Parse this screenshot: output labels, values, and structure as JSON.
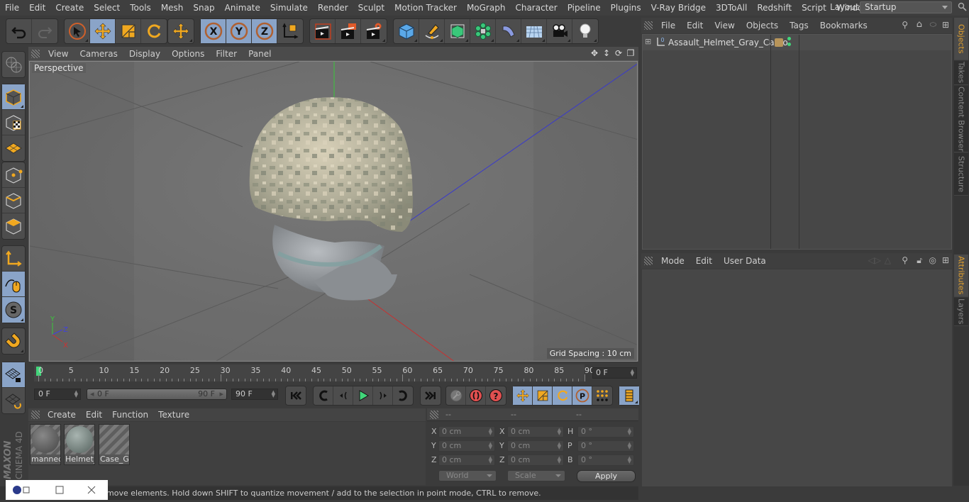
{
  "menubar": {
    "items": [
      "File",
      "Edit",
      "Create",
      "Select",
      "Tools",
      "Mesh",
      "Snap",
      "Animate",
      "Simulate",
      "Render",
      "Sculpt",
      "Motion Tracker",
      "MoGraph",
      "Character",
      "Pipeline",
      "Plugins",
      "V-Ray Bridge",
      "3DToAll",
      "Redshift",
      "Script",
      "Window",
      "Help"
    ],
    "layout_label": "Layout:",
    "layout_value": "Startup"
  },
  "toolbar": {
    "icons": [
      "undo-icon",
      "redo-icon",
      "live-selection-icon",
      "move-icon",
      "scale-icon",
      "rotate-icon",
      "recent-tool-icon",
      "x-axis-lock-icon",
      "y-axis-lock-icon",
      "z-axis-lock-icon",
      "coordinate-system-icon",
      "render-view-icon",
      "render-to-picture-viewer-icon",
      "render-settings-icon",
      "cube-icon",
      "pen-spline-icon",
      "subdivision-surface-icon",
      "cloner-icon",
      "deformer-bend-icon",
      "floor-icon",
      "camera-icon",
      "light-icon"
    ]
  },
  "left_toolbar": {
    "icons": [
      "make-editable-icon",
      "model-mode-icon",
      "texture-mode-icon",
      "workplane-mode-icon",
      "points-mode-icon",
      "edges-mode-icon",
      "polygons-mode-icon",
      "axis-mode-icon",
      "tweak-mode-icon",
      "solo-icon",
      "snap-icon",
      "workplane-lock-icon",
      "workplane-align-icon"
    ]
  },
  "viewport": {
    "menu": [
      "View",
      "Cameras",
      "Display",
      "Options",
      "Filter",
      "Panel"
    ],
    "camera_label": "Perspective",
    "grid_spacing": "Grid Spacing : 10 cm",
    "axis_labels": {
      "y": "Y",
      "z": "Z",
      "x": "X"
    }
  },
  "timeline": {
    "ticks": [
      "0",
      "5",
      "10",
      "15",
      "20",
      "25",
      "30",
      "35",
      "40",
      "45",
      "50",
      "55",
      "60",
      "65",
      "70",
      "75",
      "80",
      "85",
      "90"
    ],
    "current_frame": "0 F"
  },
  "transport": {
    "start_field": "0 F",
    "range_min": "0 F",
    "range_max": "90 F",
    "end_field": "90 F",
    "colors": {
      "play": "#41d67a",
      "record": "#e05050"
    }
  },
  "material_manager": {
    "menu": [
      "Create",
      "Edit",
      "Function",
      "Texture"
    ],
    "materials": [
      {
        "name": "manneq"
      },
      {
        "name": "Helmet_"
      },
      {
        "name": "Case_Gr"
      }
    ]
  },
  "coordinates": {
    "headers": [
      "--",
      "--",
      "--"
    ],
    "rows": [
      {
        "l1": "X",
        "v1": "0 cm",
        "l2": "X",
        "v2": "0 cm",
        "l3": "H",
        "v3": "0 °"
      },
      {
        "l1": "Y",
        "v1": "0 cm",
        "l2": "Y",
        "v2": "0 cm",
        "l3": "P",
        "v3": "0 °"
      },
      {
        "l1": "Z",
        "v1": "0 cm",
        "l2": "Z",
        "v2": "0 cm",
        "l3": "B",
        "v3": "0 °"
      }
    ],
    "mode_dropdown": "World",
    "transform_dropdown": "Scale",
    "apply_label": "Apply"
  },
  "object_manager": {
    "menu": [
      "File",
      "Edit",
      "View",
      "Objects",
      "Tags",
      "Bookmarks"
    ],
    "objects": [
      {
        "name": "Assault_Helmet_Gray_Camo",
        "layer_color": "#b8955a"
      }
    ]
  },
  "attribute_manager": {
    "menu": [
      "Mode",
      "Edit",
      "User Data"
    ]
  },
  "side_tabs": {
    "top": [
      "Objects",
      "Takes",
      "Content Browser",
      "Structure"
    ],
    "bottom": [
      "Attributes",
      "Layers"
    ],
    "accent": "#e0a030"
  },
  "branding": {
    "line1": "MAXON",
    "line2": "CINEMA 4D"
  },
  "status": {
    "text": "move elements. Hold down SHIFT to quantize movement / add to the selection in point mode, CTRL to remove."
  }
}
